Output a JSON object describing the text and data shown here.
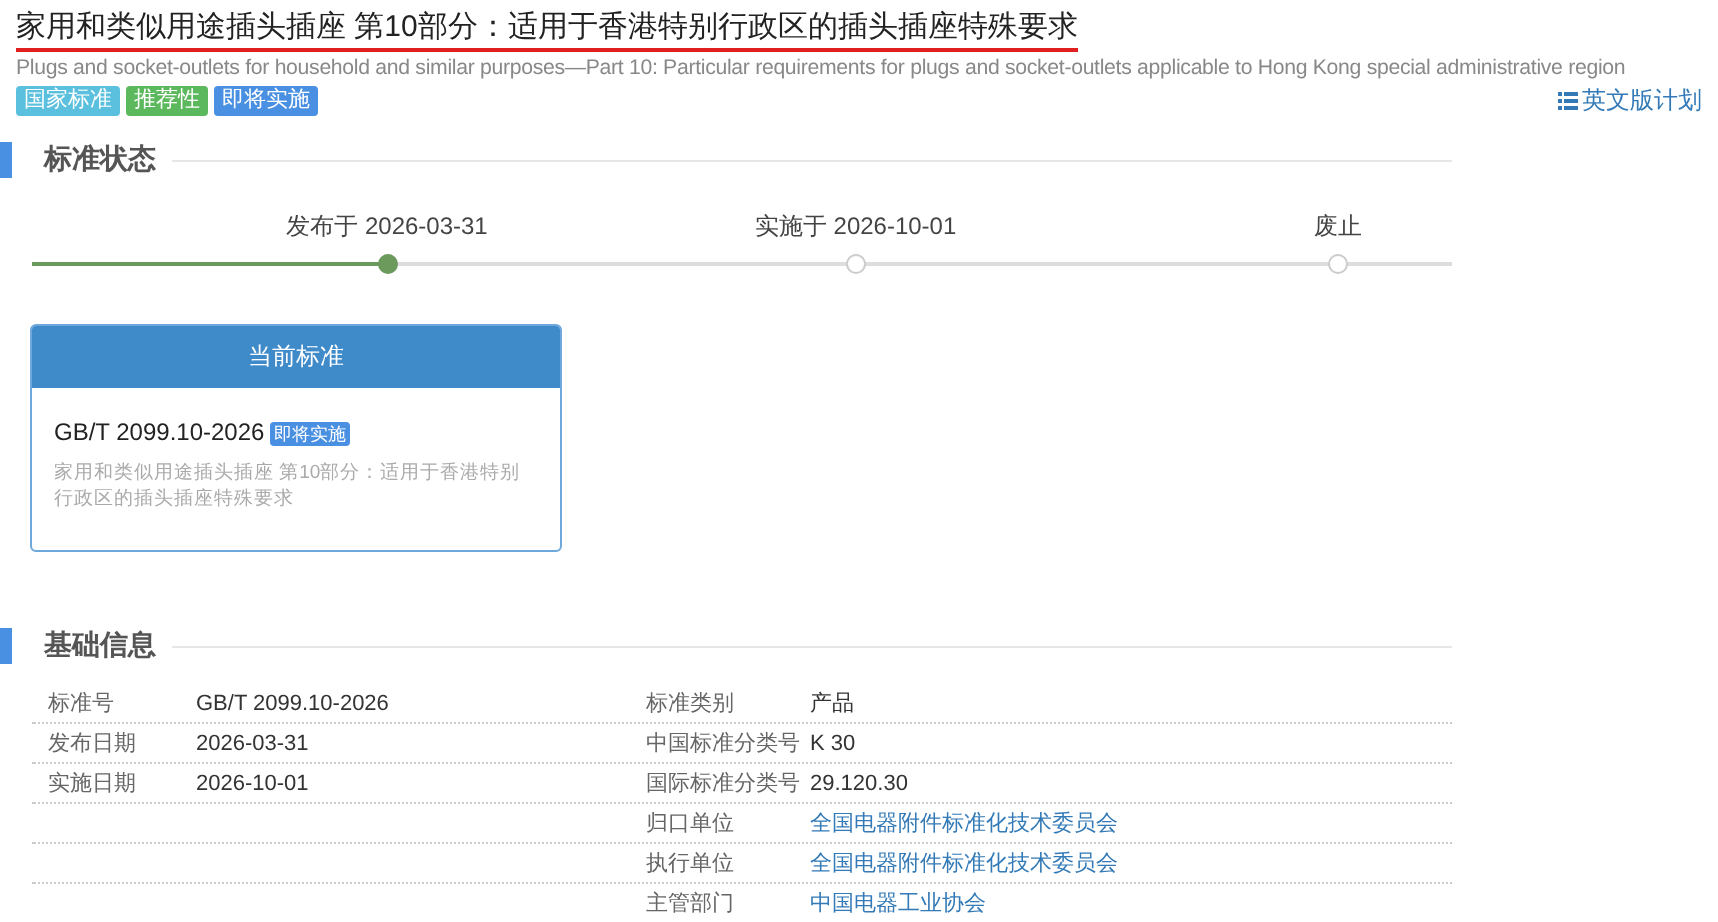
{
  "title": "家用和类似用途插头插座 第10部分：适用于香港特别行政区的插头插座特殊要求",
  "subtitle": "Plugs and socket-outlets for household and similar purposes—Part 10: Particular requirements for plugs and socket-outlets applicable to Hong Kong special administrative region",
  "tags": [
    {
      "label": "国家标准",
      "color": "#5bc0de"
    },
    {
      "label": "推荐性",
      "color": "#5cb85c"
    },
    {
      "label": "即将实施",
      "color": "#4a90e2"
    }
  ],
  "english_plan_link": "英文版计划",
  "status_section": {
    "heading": "标准状态",
    "progress": {
      "level": 0.25
    },
    "timeline": [
      {
        "label": "发布于 2026-03-31",
        "reached": true
      },
      {
        "label": "实施于 2026-10-01",
        "reached": false
      },
      {
        "label": "废止",
        "reached": false
      }
    ],
    "card": {
      "header": "当前标准",
      "code": "GB/T 2099.10-2026",
      "badge": "即将实施",
      "description": "家用和类似用途插头插座 第10部分：适用于香港特别行政区的插头插座特殊要求"
    }
  },
  "basic_info": {
    "heading": "基础信息",
    "rows": [
      {
        "left_label": "标准号",
        "left_value": "GB/T 2099.10-2026",
        "right_label": "标准类别",
        "right_value": "产品",
        "right_link": false
      },
      {
        "left_label": "发布日期",
        "left_value": "2026-03-31",
        "right_label": "中国标准分类号",
        "right_value": "K 30",
        "right_link": false
      },
      {
        "left_label": "实施日期",
        "left_value": "2026-10-01",
        "right_label": "国际标准分类号",
        "right_value": "29.120.30",
        "right_link": false
      },
      {
        "right_label": "归口单位",
        "right_value": "全国电器附件标准化技术委员会",
        "right_link": true
      },
      {
        "right_label": "执行单位",
        "right_value": "全国电器附件标准化技术委员会",
        "right_link": true
      },
      {
        "right_label": "主管部门",
        "right_value": "中国电器工业协会",
        "right_link": true
      }
    ]
  }
}
